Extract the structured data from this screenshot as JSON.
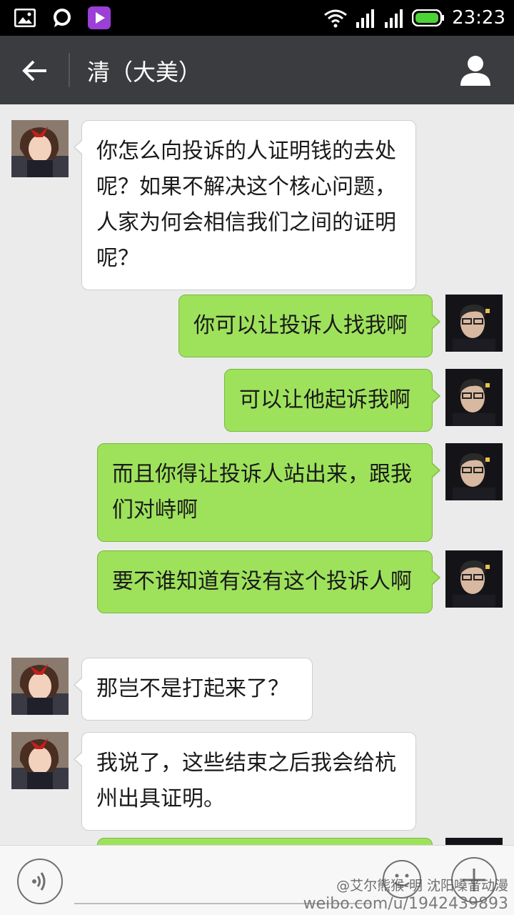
{
  "status_bar": {
    "time": "23:23",
    "left_icons": [
      "gallery-icon",
      "chat-bubble-icon",
      "video-play-icon"
    ],
    "right_icons": [
      "wifi-icon",
      "signal-icon",
      "signal-icon",
      "battery-icon"
    ]
  },
  "header": {
    "title": "清（大美）",
    "back_icon": "back-arrow-icon",
    "profile_icon": "person-icon"
  },
  "messages": [
    {
      "sender": "other",
      "text": "你怎么向投诉的人证明钱的去处呢？如果不解决这个核心问题，人家为何会相信我们之间的证明呢？"
    },
    {
      "sender": "self",
      "text": "你可以让投诉人找我啊"
    },
    {
      "sender": "self",
      "text": "可以让他起诉我啊"
    },
    {
      "sender": "self",
      "text": "而且你得让投诉人站出来，跟我们对峙啊"
    },
    {
      "sender": "self",
      "text": "要不谁知道有没有这个投诉人啊"
    },
    {
      "sender": "other",
      "text": "那岂不是打起来了？"
    },
    {
      "sender": "other",
      "text": "我说了，这些结束之后我会给杭州出具证明。"
    },
    {
      "sender": "self",
      "text": ""
    }
  ],
  "input_bar": {
    "placeholder": "",
    "icons": [
      "voice-icon",
      "emoji-icon",
      "plus-icon"
    ]
  },
  "watermark": {
    "line1": "@艾尔熊猴-明 沈阳嗓音动漫",
    "line2": "weibo.com/u/1942439893"
  },
  "colors": {
    "outgoing_bubble": "#9ee25c",
    "incoming_bubble": "#ffffff",
    "header": "#3a3c3f",
    "background": "#ebebeb"
  }
}
